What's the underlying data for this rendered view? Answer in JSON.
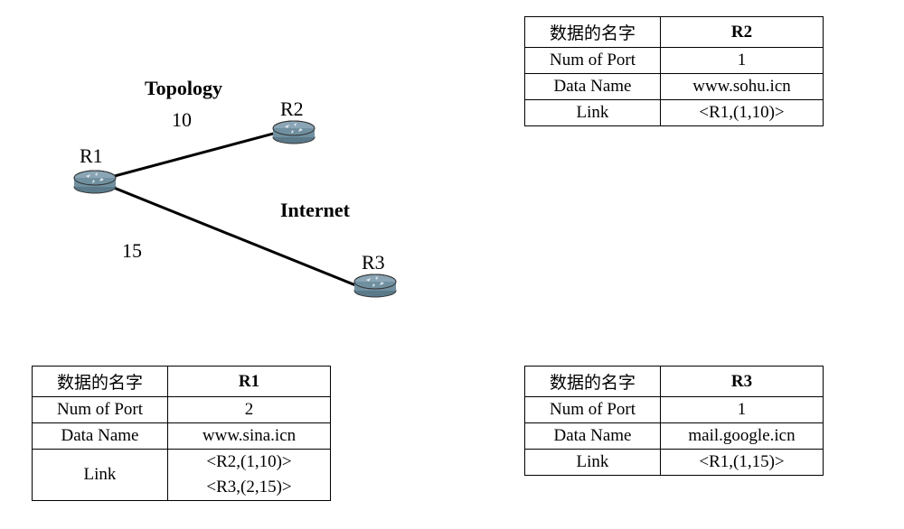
{
  "labels": {
    "topology": "Topology",
    "internet": "Internet",
    "r1": "R1",
    "r2": "R2",
    "r3": "R3",
    "weight_r1_r2": "10",
    "weight_r1_r3": "15"
  },
  "tables": {
    "header_name": "数据的名字",
    "rows": {
      "num_of_port": "Num of Port",
      "data_name": "Data Name",
      "link": "Link"
    },
    "r1": {
      "title": "R1",
      "num_of_port": "2",
      "data_name": "www.sina.icn",
      "link1": "<R2,(1,10)>",
      "link2": "<R3,(2,15)>"
    },
    "r2": {
      "title": "R2",
      "num_of_port": "1",
      "data_name": "www.sohu.icn",
      "link1": "<R1,(1,10)>"
    },
    "r3": {
      "title": "R3",
      "num_of_port": "1",
      "data_name": "mail.google.icn",
      "link1": "<R1,(1,15)>"
    }
  }
}
